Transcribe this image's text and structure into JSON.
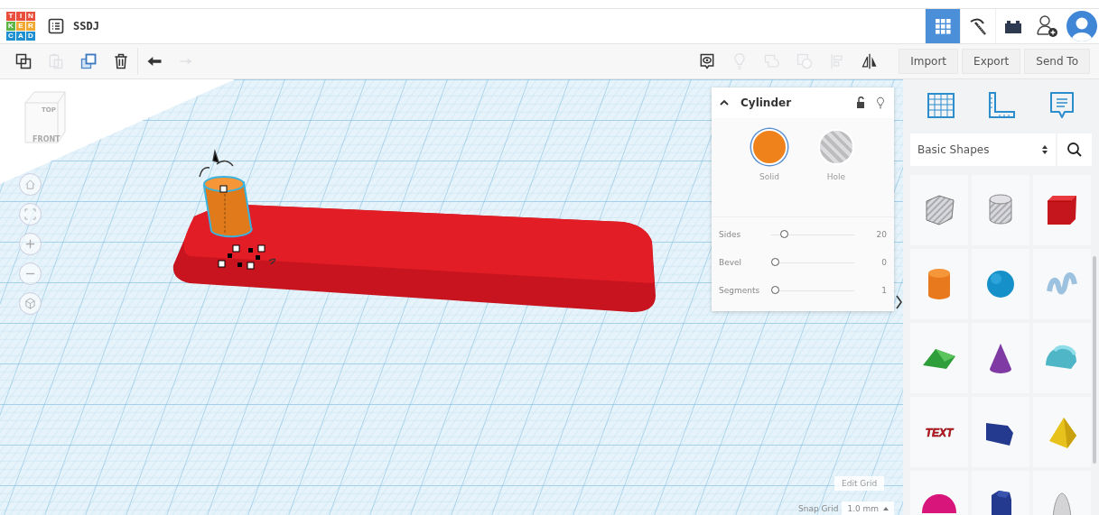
{
  "header": {
    "logo_letters": [
      "T",
      "I",
      "N",
      "K",
      "E",
      "R",
      "C",
      "A",
      "D"
    ],
    "title": "SSDJ",
    "view_modes": [
      {
        "kind": "grid",
        "selected": true
      },
      {
        "kind": "pickaxe",
        "selected": false
      },
      {
        "kind": "bricks",
        "selected": false
      }
    ]
  },
  "toolbar": {
    "edit_tools": [
      {
        "kind": "copy",
        "disabled": false
      },
      {
        "kind": "paste",
        "disabled": true
      },
      {
        "kind": "duplicate",
        "disabled": false
      },
      {
        "kind": "delete",
        "disabled": false
      },
      {
        "kind": "undo",
        "disabled": false
      },
      {
        "kind": "redo",
        "disabled": true
      }
    ],
    "shape_tools": [
      {
        "kind": "note",
        "disabled": false
      },
      {
        "kind": "bulb",
        "disabled": true
      },
      {
        "kind": "group",
        "disabled": true
      },
      {
        "kind": "ungroup",
        "disabled": true
      },
      {
        "kind": "align",
        "disabled": true
      },
      {
        "kind": "mirror",
        "disabled": false
      }
    ],
    "buttons": [
      "Import",
      "Export",
      "Send To"
    ]
  },
  "view_cube": {
    "top": "TOP",
    "front": "FRONT"
  },
  "inspector": {
    "title": "Cylinder",
    "modes": [
      {
        "kind": "solid",
        "label": "Solid",
        "selected": true
      },
      {
        "kind": "hole",
        "label": "Hole",
        "selected": false
      }
    ],
    "params": [
      {
        "label": "Sides",
        "level": 0.12,
        "value": "20"
      },
      {
        "label": "Bevel",
        "level": 0,
        "value": "0"
      },
      {
        "label": "Segments",
        "level": 0,
        "value": "1"
      }
    ]
  },
  "grid_controls": {
    "edit": "Edit Grid",
    "snap_label": "Snap Grid",
    "snap_value": "1.0 mm"
  },
  "shapes_panel": {
    "category": "Basic Shapes",
    "shapes": [
      {
        "kind": "box-hole"
      },
      {
        "kind": "cylinder-hole"
      },
      {
        "kind": "box"
      },
      {
        "kind": "cylinder"
      },
      {
        "kind": "sphere"
      },
      {
        "kind": "scribble"
      },
      {
        "kind": "roof"
      },
      {
        "kind": "cone"
      },
      {
        "kind": "round-roof"
      },
      {
        "kind": "text",
        "label": "TEXT"
      },
      {
        "kind": "wedge"
      },
      {
        "kind": "pyramid"
      },
      {
        "kind": "half-sphere"
      },
      {
        "kind": "polygon"
      },
      {
        "kind": "paraboloid"
      }
    ]
  }
}
